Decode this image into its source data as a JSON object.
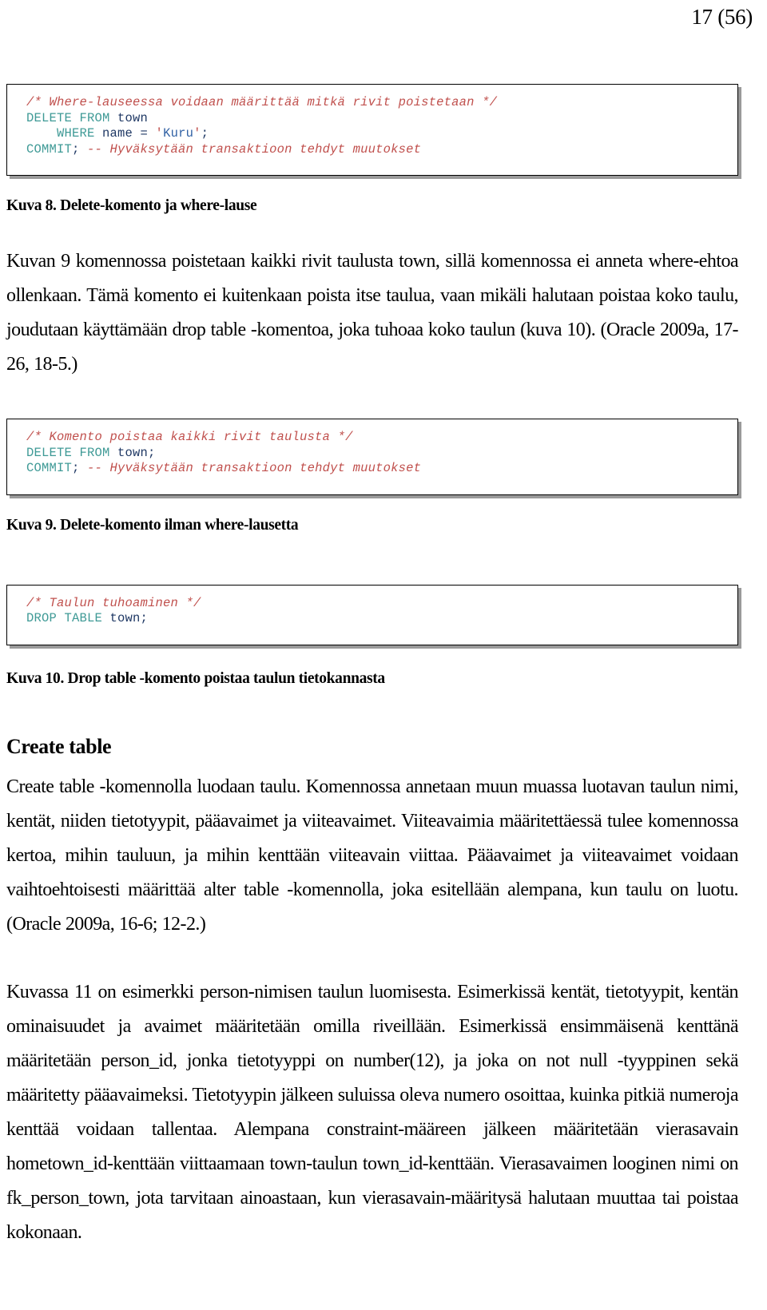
{
  "header": {
    "page_number": "17 (56)"
  },
  "code_blocks": [
    {
      "id": "delete-where",
      "lines": [
        [
          {
            "t": "/* Where-lauseessa voidaan määrittää mitkä rivit poistetaan */",
            "c": "cmt"
          }
        ],
        [
          {
            "t": "DELETE FROM ",
            "c": "kw"
          },
          {
            "t": "town",
            "c": "ident"
          }
        ],
        [
          {
            "t": "    ",
            "c": "plain"
          },
          {
            "t": "WHERE ",
            "c": "kw"
          },
          {
            "t": "name = ",
            "c": "ident"
          },
          {
            "t": "'",
            "c": "quote"
          },
          {
            "t": "Kuru",
            "c": "str"
          },
          {
            "t": "'",
            "c": "quote"
          },
          {
            "t": ";",
            "c": "ident"
          }
        ],
        [
          {
            "t": "COMMIT",
            "c": "kw"
          },
          {
            "t": "; ",
            "c": "ident"
          },
          {
            "t": "-- Hyväksytään transaktioon tehdyt muutokset",
            "c": "cmt"
          }
        ]
      ]
    },
    {
      "id": "delete-all",
      "lines": [
        [
          {
            "t": "/* Komento poistaa kaikki rivit taulusta */",
            "c": "cmt"
          }
        ],
        [
          {
            "t": "DELETE FROM ",
            "c": "kw"
          },
          {
            "t": "town;",
            "c": "ident"
          }
        ],
        [
          {
            "t": "COMMIT",
            "c": "kw"
          },
          {
            "t": "; ",
            "c": "ident"
          },
          {
            "t": "-- Hyväksytään transaktioon tehdyt muutokset",
            "c": "cmt"
          }
        ]
      ]
    },
    {
      "id": "drop-table",
      "lines": [
        [
          {
            "t": "/* Taulun tuhoaminen */",
            "c": "cmt"
          }
        ],
        [
          {
            "t": "DROP TABLE ",
            "c": "kw"
          },
          {
            "t": "town;",
            "c": "ident"
          }
        ]
      ]
    }
  ],
  "captions": {
    "kuva8": "Kuva 8. Delete-komento ja where-lause",
    "kuva9": "Kuva 9. Delete-komento ilman where-lausetta",
    "kuva10": "Kuva 10. Drop table -komento poistaa taulun tietokannasta"
  },
  "headings": {
    "create_table": "Create table"
  },
  "paragraphs": {
    "p1": "Kuvan 9 komennossa poistetaan kaikki rivit taulusta town, sillä komennossa ei anneta where-ehtoa ollenkaan. Tämä komento ei kuitenkaan poista itse taulua, vaan mikäli halutaan poistaa koko taulu, joudutaan käyttämään drop table -komentoa, joka tuhoaa koko taulun (kuva 10). (Oracle 2009a, 17-26, 18-5.)",
    "p2": "Create table -komennolla luodaan taulu. Komennossa annetaan muun muassa luotavan taulun nimi, kentät, niiden tietotyypit, pääavaimet ja viiteavaimet. Viiteavaimia määritettäessä tulee komennossa kertoa, mihin tauluun, ja mihin kenttään viiteavain viittaa. Pääavaimet ja viiteavaimet voidaan vaihtoehtoisesti määrittää alter table -komennolla, joka esitellään alempana, kun taulu on luotu. (Oracle 2009a, 16-6; 12-2.)",
    "p3": "Kuvassa 11 on esimerkki person-nimisen taulun luomisesta. Esimerkissä kentät, tietotyypit, kentän ominaisuudet ja avaimet määritetään omilla riveillään. Esimerkissä ensimmäisenä kenttänä määritetään person_id, jonka tietotyyppi on number(12), ja joka on not null -tyyppinen sekä määritetty pääavaimeksi. Tietotyypin jälkeen suluissa oleva numero osoittaa, kuinka pitkiä numeroja kenttää voidaan tallentaa. Alempana constraint-määreen jälkeen määritetään vierasavain hometown_id-kenttään viittaamaan town-taulun town_id-kenttään. Vierasavaimen looginen nimi on fk_person_town, jota tarvitaan ainoastaan, kun vierasavain-määritysä halutaan muuttaa tai poistaa kokonaan."
  },
  "colors": {
    "comment": "#c0504d",
    "keyword": "#3f9a96",
    "identifier": "#1f3864",
    "string": "#2e5fa3",
    "box_border": "#000000",
    "box_shadow": "#9a9a9a",
    "text": "#000000",
    "background": "#ffffff"
  }
}
